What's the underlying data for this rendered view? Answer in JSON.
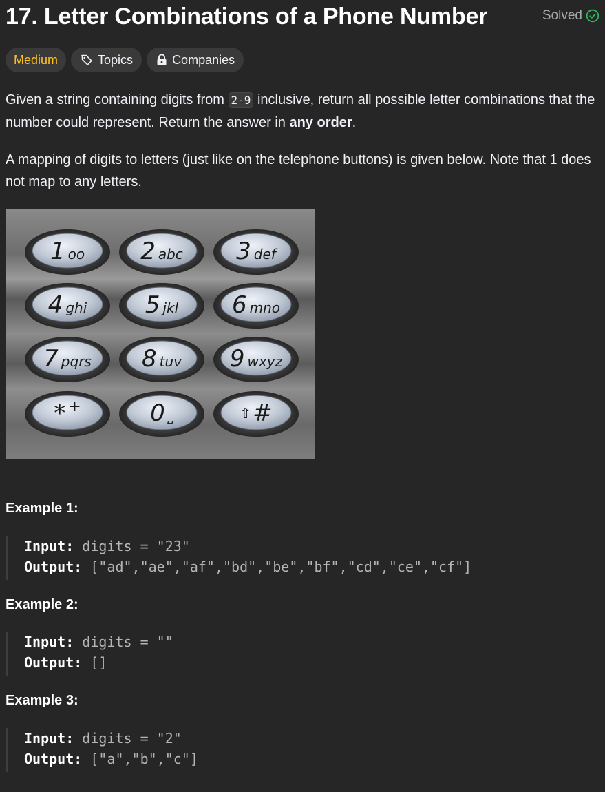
{
  "problem": {
    "title": "17. Letter Combinations of a Phone Number",
    "status": "Solved"
  },
  "tags": {
    "difficulty": "Medium",
    "topics": "Topics",
    "companies": "Companies"
  },
  "description": {
    "p1_before": "Given a string containing digits from ",
    "p1_code": "2-9",
    "p1_middle": " inclusive, return all possible letter combinations that the number could represent. Return the answer in ",
    "p1_bold": "any order",
    "p1_after": ".",
    "p2": "A mapping of digits to letters (just like on the telephone buttons) is given below. Note that 1 does not map to any letters."
  },
  "keypad": {
    "keys": [
      {
        "digit": "1",
        "letters": "oo"
      },
      {
        "digit": "2",
        "letters": "abc"
      },
      {
        "digit": "3",
        "letters": "def"
      },
      {
        "digit": "4",
        "letters": "ghi"
      },
      {
        "digit": "5",
        "letters": "jkl"
      },
      {
        "digit": "6",
        "letters": "mno"
      },
      {
        "digit": "7",
        "letters": "pqrs"
      },
      {
        "digit": "8",
        "letters": "tuv"
      },
      {
        "digit": "9",
        "letters": "wxyz"
      },
      {
        "digit": "*",
        "letters": "+"
      },
      {
        "digit": "0",
        "letters": "⎵"
      },
      {
        "digit": "#",
        "letters": "⇧"
      }
    ]
  },
  "examples": [
    {
      "title": "Example 1:",
      "input_label": "Input:",
      "input_value": " digits = \"23\"",
      "output_label": "Output:",
      "output_value": " [\"ad\",\"ae\",\"af\",\"bd\",\"be\",\"bf\",\"cd\",\"ce\",\"cf\"]"
    },
    {
      "title": "Example 2:",
      "input_label": "Input:",
      "input_value": " digits = \"\"",
      "output_label": "Output:",
      "output_value": " []"
    },
    {
      "title": "Example 3:",
      "input_label": "Input:",
      "input_value": " digits = \"2\"",
      "output_label": "Output:",
      "output_value": " [\"a\",\"b\",\"c\"]"
    }
  ],
  "colors": {
    "background": "#262626",
    "medium": "#ffc01e",
    "solved_check": "#2cbb5d",
    "tag_bg": "#3a3a3a"
  }
}
